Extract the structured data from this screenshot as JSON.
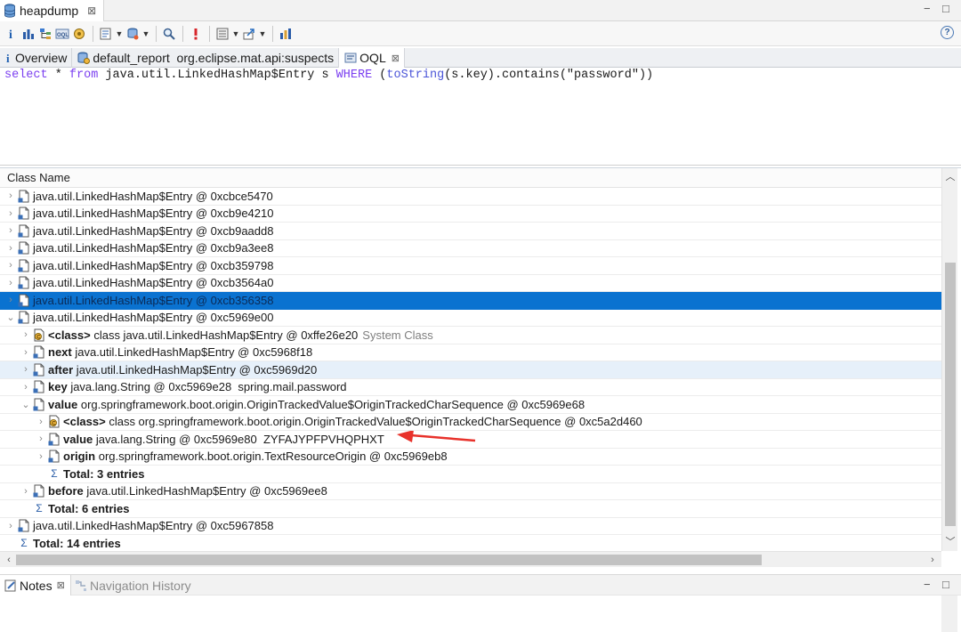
{
  "editor_tab": {
    "title": "heapdump",
    "close": "⊠"
  },
  "window_controls": {
    "minimize": "−",
    "maximize": "□"
  },
  "help": "?",
  "tabs": [
    {
      "label": "Overview"
    },
    {
      "label": "default_report  org.eclipse.mat.api:suspects"
    },
    {
      "label": "OQL",
      "close": "⊠"
    }
  ],
  "query": {
    "kw_select": "select",
    "star": " * ",
    "kw_from": "from",
    "class_part": " java.util.LinkedHashMap$Entry s ",
    "kw_where": "WHERE",
    "open": " (",
    "fn": "toString",
    "rest": "(s.key).contains(\"password\"))"
  },
  "results": {
    "column_header": "Class Name",
    "rows": [
      {
        "text": "java.util.LinkedHashMap$Entry @ 0xcbce5470"
      },
      {
        "text": "java.util.LinkedHashMap$Entry @ 0xcb9e4210"
      },
      {
        "text": "java.util.LinkedHashMap$Entry @ 0xcb9aadd8"
      },
      {
        "text": "java.util.LinkedHashMap$Entry @ 0xcb9a3ee8"
      },
      {
        "text": "java.util.LinkedHashMap$Entry @ 0xcb359798"
      },
      {
        "text": "java.util.LinkedHashMap$Entry @ 0xcb3564a0"
      },
      {
        "text": "java.util.LinkedHashMap$Entry @ 0xcb356358"
      },
      {
        "text": "java.util.LinkedHashMap$Entry @ 0xc5969e00"
      },
      {
        "bold": "<class>",
        "text": " class java.util.LinkedHashMap$Entry @ 0xffe26e20",
        "extra": "System Class"
      },
      {
        "bold": "next",
        "text": " java.util.LinkedHashMap$Entry @ 0xc5968f18"
      },
      {
        "bold": "after",
        "text": " java.util.LinkedHashMap$Entry @ 0xc5969d20"
      },
      {
        "bold": "key",
        "text": " java.lang.String @ 0xc5969e28  spring.mail.password"
      },
      {
        "bold": "value",
        "text": " org.springframework.boot.origin.OriginTrackedValue$OriginTrackedCharSequence @ 0xc5969e68"
      },
      {
        "bold": "<class>",
        "text": " class org.springframework.boot.origin.OriginTrackedValue$OriginTrackedCharSequence @ 0xc5a2d460"
      },
      {
        "bold": "value",
        "text": " java.lang.String @ 0xc5969e80  ZYFAJYPFPVHQPHXT"
      },
      {
        "bold": "origin",
        "text": " org.springframework.boot.origin.TextResourceOrigin @ 0xc5969eb8"
      },
      {
        "bold": "Total: 3 entries"
      },
      {
        "bold": "before",
        "text": " java.util.LinkedHashMap$Entry @ 0xc5969ee8"
      },
      {
        "bold": "Total: 6 entries"
      },
      {
        "text": "java.util.LinkedHashMap$Entry @ 0xc5967858"
      },
      {
        "bold": "Total: 14 entries"
      }
    ]
  },
  "notes_panel": {
    "notes_label": "Notes",
    "notes_close": "⊠",
    "history_label": "Navigation History"
  },
  "colors": {
    "selection": "#0a72d0",
    "hover_row": "#e6f0fa",
    "keyword": "#7b3ff0",
    "function": "#4b55d8",
    "annotation_arrow": "#e8322b"
  },
  "icons": [
    "database-icon",
    "info-icon",
    "histogram-icon",
    "dominator-tree-icon",
    "oql-icon",
    "thread-icon",
    "run-report-icon",
    "query-browser-icon",
    "search-icon",
    "leak-suspect-icon",
    "group-icon",
    "export-icon",
    "calculate-icon",
    "help-icon",
    "document-icon",
    "sigma-icon",
    "notes-icon",
    "history-icon"
  ]
}
